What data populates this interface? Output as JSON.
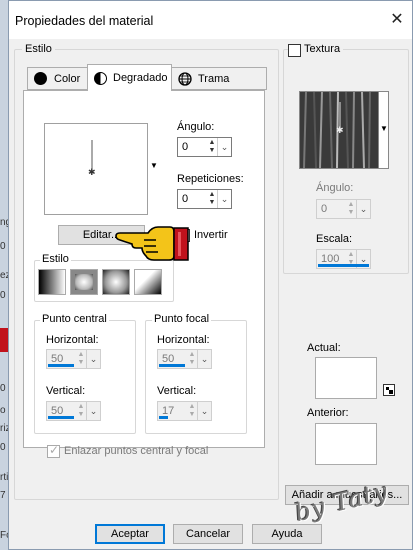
{
  "dialog": {
    "title": "Propiedades del material",
    "close_glyph": "✕"
  },
  "background_app": {
    "fragments": [
      "ng",
      "0",
      "ez",
      "0",
      "0",
      "o f",
      "riz",
      "0",
      "rti",
      "7",
      "Fo"
    ]
  },
  "estilo_group": {
    "label": "Estilo"
  },
  "tabs": [
    {
      "label": "Color",
      "icon": "color-circle-icon",
      "active": false
    },
    {
      "label": "Degradado",
      "icon": "gradient-circle-icon",
      "active": true
    },
    {
      "label": "Trama",
      "icon": "pattern-globe-icon",
      "active": false
    }
  ],
  "gradient": {
    "angle_label": "Ángulo:",
    "angle_value": "0",
    "repeat_label": "Repeticiones:",
    "repeat_value": "0",
    "edit_button": "Editar...",
    "invert_label": "Invertir",
    "invert_checked": true,
    "style_group_label": "Estilo",
    "style_types": [
      "linear",
      "rectangular",
      "radial",
      "sunburst"
    ]
  },
  "punto_central": {
    "label": "Punto central",
    "horizontal_label": "Horizontal:",
    "horizontal_value": "50",
    "horizontal_fill": 0.5,
    "vertical_label": "Vertical:",
    "vertical_value": "50",
    "vertical_fill": 0.5
  },
  "punto_focal": {
    "label": "Punto focal",
    "horizontal_label": "Horizontal:",
    "horizontal_value": "50",
    "horizontal_fill": 0.5,
    "vertical_label": "Vertical:",
    "vertical_value": "17",
    "vertical_fill": 0.17
  },
  "link_points": {
    "label": "Enlazar puntos central y focal",
    "checked": true,
    "enabled": false
  },
  "texture": {
    "checkbox_label": "Textura",
    "checked": false,
    "angle_label": "Ángulo:",
    "angle_value": "0",
    "scale_label": "Escala:",
    "scale_value": "100",
    "scale_fill": 1.0
  },
  "preview": {
    "current_label": "Actual:",
    "previous_label": "Anterior:"
  },
  "buttons": {
    "add_swatches": "Añadir a muestrarios...",
    "ok": "Aceptar",
    "cancel": "Cancelar",
    "help": "Ayuda"
  },
  "watermark": "by Taty",
  "colors": {
    "accent": "#0078d7",
    "cursor_fill": "#f3c419",
    "cursor_cuff": "#c1121c"
  }
}
